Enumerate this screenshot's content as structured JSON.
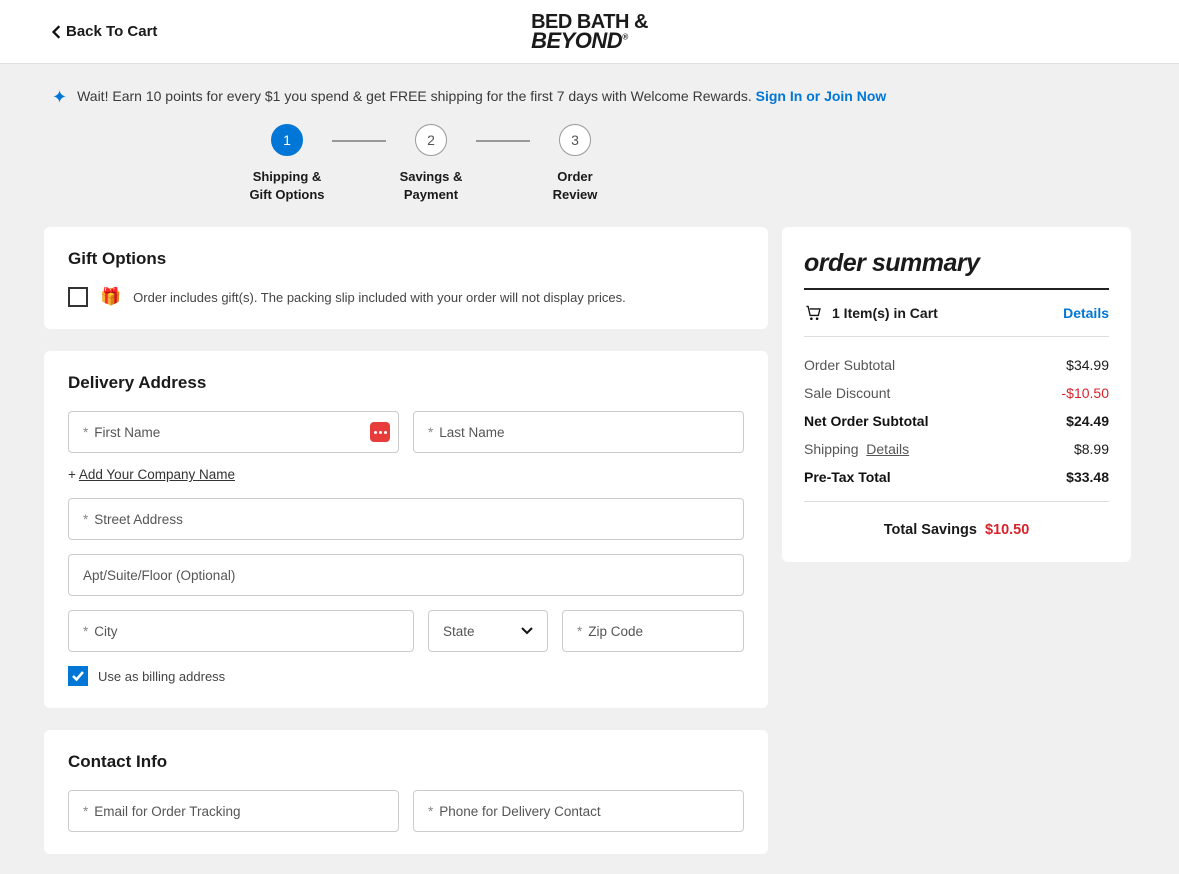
{
  "header": {
    "back_label": "Back To Cart",
    "logo_line1": "BED BATH &",
    "logo_line2": "BEYOND"
  },
  "banner": {
    "text": "Wait! Earn 10 points for every $1 you spend & get FREE shipping for the first 7 days with Welcome Rewards. ",
    "cta": "Sign In or Join Now"
  },
  "stepper": {
    "steps": [
      {
        "num": "1",
        "label_l1": "Shipping &",
        "label_l2": "Gift Options",
        "active": true
      },
      {
        "num": "2",
        "label_l1": "Savings &",
        "label_l2": "Payment",
        "active": false
      },
      {
        "num": "3",
        "label_l1": "Order",
        "label_l2": "Review",
        "active": false
      }
    ]
  },
  "gift": {
    "heading": "Gift Options",
    "checkbox_checked": false,
    "desc": "Order includes gift(s). The packing slip included with your order will not display prices."
  },
  "delivery": {
    "heading": "Delivery Address",
    "first_name": "First Name",
    "last_name": "Last Name",
    "add_company_prefix": "+ ",
    "add_company": "Add Your Company Name",
    "street": "Street Address",
    "apt": "Apt/Suite/Floor (Optional)",
    "city": "City",
    "state": "State",
    "zip": "Zip Code",
    "use_billing_checked": true,
    "use_billing_label": "Use as billing address"
  },
  "contact": {
    "heading": "Contact Info",
    "email": "Email for Order Tracking",
    "phone": "Phone for Delivery Contact"
  },
  "summary": {
    "title": "order summary",
    "cart_items_label": "1 Item(s) in Cart",
    "details_label": "Details",
    "rows": {
      "subtotal_label": "Order Subtotal",
      "subtotal_val": "$34.99",
      "sale_label": "Sale Discount",
      "sale_val": "-$10.50",
      "net_label": "Net Order Subtotal",
      "net_val": "$24.49",
      "ship_label": "Shipping",
      "ship_details": "Details",
      "ship_val": "$8.99",
      "pretax_label": "Pre-Tax Total",
      "pretax_val": "$33.48"
    },
    "total_savings_label": "Total Savings",
    "total_savings_val": "$10.50"
  }
}
